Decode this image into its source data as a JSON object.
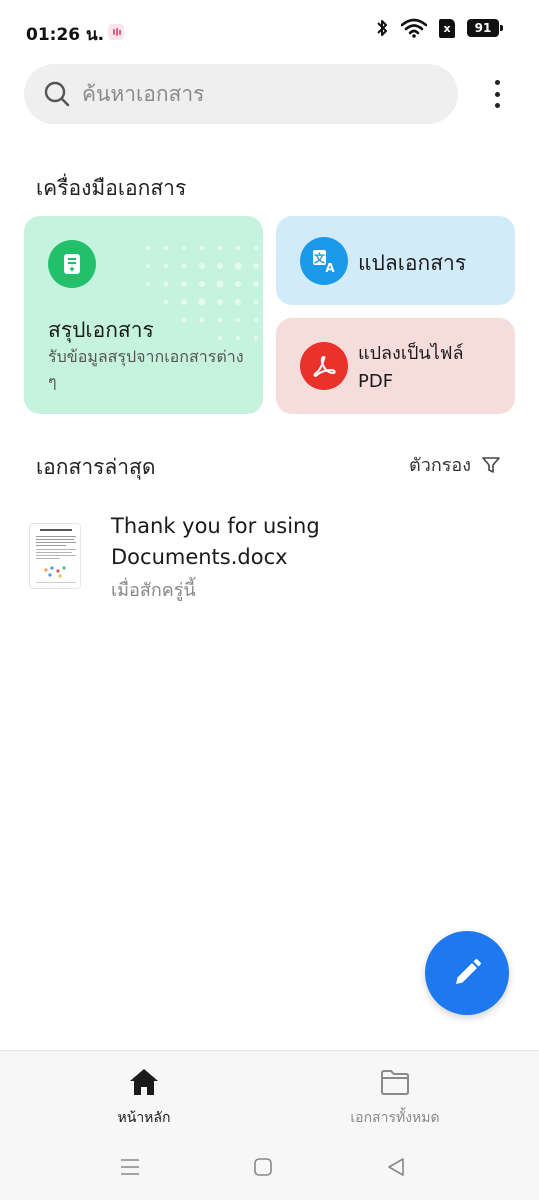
{
  "status_bar": {
    "time": "01:26 น.",
    "battery": "91",
    "sim_label": "x"
  },
  "search": {
    "placeholder": "ค้นหาเอกสาร"
  },
  "tools": {
    "section_title": "เครื่องมือเอกสาร",
    "summary": {
      "title": "สรุปเอกสาร",
      "description": "รับข้อมูลสรุปจากเอกสารต่าง ๆ",
      "icon": "document-summary-icon",
      "color": "#22c06a"
    },
    "translate": {
      "label": "แปลเอกสาร",
      "icon": "translate-icon",
      "color": "#1a9ae8"
    },
    "convert": {
      "label_line1": "แปลงเป็นไฟล์",
      "label_line2": "PDF",
      "icon": "pdf-icon",
      "color": "#e8322a"
    }
  },
  "recent": {
    "section_title": "เอกสารล่าสุด",
    "filter_label": "ตัวกรอง",
    "documents": [
      {
        "title": "Thank you for using Documents.docx",
        "time": "เมื่อสักครู่นี้"
      }
    ]
  },
  "fab": {
    "icon": "pencil-icon",
    "color": "#1e78f0"
  },
  "bottom_nav": {
    "items": [
      {
        "label": "หน้าหลัก",
        "icon": "home-icon",
        "active": true
      },
      {
        "label": "เอกสารทั้งหมด",
        "icon": "folder-icon",
        "active": false
      }
    ]
  }
}
